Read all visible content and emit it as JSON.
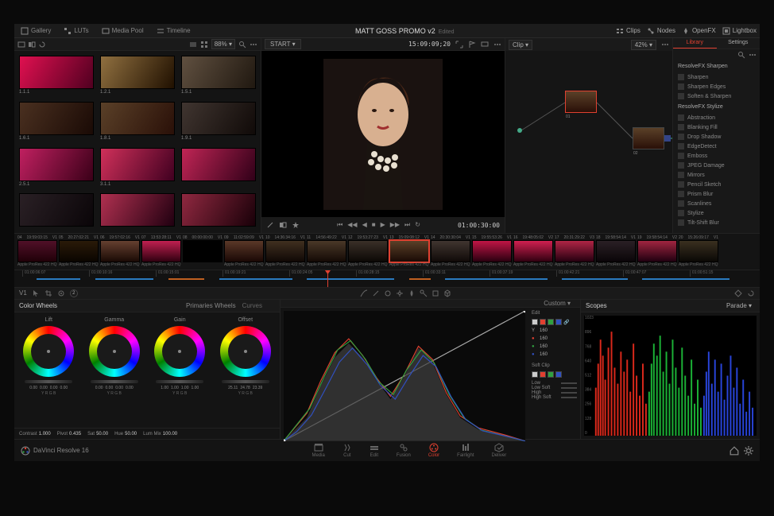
{
  "topbar": {
    "tabs": [
      "Gallery",
      "LUTs",
      "Media Pool",
      "Timeline"
    ],
    "title": "MATT GOSS PROMO v2",
    "edited": "Edited",
    "right": [
      "Clips",
      "Nodes",
      "OpenFX",
      "Lightbox"
    ]
  },
  "gallery": {
    "zoom": "88%",
    "thumbs": [
      {
        "label": "1.1.1",
        "bg": "linear-gradient(120deg,#e01050,#500020)"
      },
      {
        "label": "1.2.1",
        "bg": "linear-gradient(120deg,#907040,#201000)"
      },
      {
        "label": "1.5.1",
        "bg": "linear-gradient(120deg,#605040,#201810)"
      },
      {
        "label": "1.6.1",
        "bg": "linear-gradient(120deg,#4a3020,#1a0a05)"
      },
      {
        "label": "1.8.1",
        "bg": "linear-gradient(120deg,#5a4028,#2a1008)"
      },
      {
        "label": "1.9.1",
        "bg": "linear-gradient(120deg,#403530,#100a08)"
      },
      {
        "label": "2.5.1",
        "bg": "linear-gradient(120deg,#c02060,#3a0018)"
      },
      {
        "label": "3.1.1",
        "bg": "linear-gradient(120deg,#d0305a,#400020)"
      },
      {
        "label": "",
        "bg": "linear-gradient(120deg,#c02555,#300018)"
      },
      {
        "label": "",
        "bg": "linear-gradient(120deg,#2a2025,#0a0508)"
      },
      {
        "label": "",
        "bg": "linear-gradient(120deg,#b03050,#200010)"
      },
      {
        "label": "",
        "bg": "linear-gradient(120deg,#902840,#180008)"
      }
    ]
  },
  "viewer": {
    "start": "START",
    "tc_left": "15:09:09;20",
    "zoom": "42%",
    "tc_right": "01:00:30:00"
  },
  "node_toolbar": {
    "mode": "Clip"
  },
  "library": {
    "tabs": [
      "Library",
      "Settings"
    ],
    "active_tab": 0,
    "groups": [
      {
        "header": "ResolveFX Sharpen",
        "items": [
          "Sharpen",
          "Sharpen Edges",
          "Soften & Sharpen"
        ]
      },
      {
        "header": "ResolveFX Stylize",
        "items": [
          "Abstraction",
          "Blanking Fill",
          "Drop Shadow",
          "EdgeDetect",
          "Emboss",
          "JPEG Damage",
          "Mirrors",
          "Pencil Sketch",
          "Prism Blur",
          "Scanlines",
          "Stylize",
          "Tilt-Shift Blur"
        ]
      }
    ]
  },
  "clips": [
    {
      "n": "04",
      "tc": "19:59:03:15",
      "track": "V1",
      "codec": "Apple ProRes 422 HQ",
      "bg": "linear-gradient(#501028,#200008)"
    },
    {
      "n": "05",
      "tc": "20:27:02:21",
      "track": "V1",
      "codec": "Apple ProRes 422 HQ",
      "bg": "linear-gradient(#2a1a08,#0a0500)"
    },
    {
      "n": "06",
      "tc": "19:57:02:16",
      "track": "V1",
      "codec": "Apple ProRes 422 HQ",
      "bg": "linear-gradient(#654030,#1a0a05)"
    },
    {
      "n": "07",
      "tc": "13:53:28:11",
      "track": "V1",
      "codec": "Apple ProRes 422 HQ",
      "bg": "linear-gradient(#c02050,#300010)"
    },
    {
      "n": "08",
      "tc": "00:00:00:00",
      "track": "V1",
      "codec": "",
      "bg": "#000"
    },
    {
      "n": "09",
      "tc": "11:02:59:09",
      "track": "V1",
      "codec": "Apple ProRes 422 HQ",
      "bg": "linear-gradient(#5a3828,#1a0805)"
    },
    {
      "n": "10",
      "tc": "14:36:34:16",
      "track": "V1",
      "codec": "Apple ProRes 422 HQ",
      "bg": "linear-gradient(#403020,#100805)"
    },
    {
      "n": "11",
      "tc": "14:56:49:22",
      "track": "V1",
      "codec": "Apple ProRes 422 HQ",
      "bg": "linear-gradient(#4a3828,#140a05)"
    },
    {
      "n": "12",
      "tc": "19:53:27:23",
      "track": "V1",
      "codec": "Apple ProRes 422 HQ",
      "bg": "linear-gradient(#3a3028,#0c0805)"
    },
    {
      "n": "13",
      "tc": "15:09:08:12",
      "track": "V1",
      "codec": "Apple ProRes 422 HQ",
      "bg": "linear-gradient(#5a4028,#1a0a05)",
      "selected": true
    },
    {
      "n": "14",
      "tc": "20:30:30:04",
      "track": "V1",
      "codec": "Apple ProRes 422 HQ",
      "bg": "linear-gradient(#403530,#100a08)"
    },
    {
      "n": "15",
      "tc": "19:55:53:26",
      "track": "V1",
      "codec": "Apple ProRes 422 HQ",
      "bg": "linear-gradient(#c01545,#2a0010)"
    },
    {
      "n": "16",
      "tc": "19:48:05:02",
      "track": "V2",
      "codec": "Apple ProRes 422 HQ",
      "bg": "linear-gradient(#d02050,#300010)"
    },
    {
      "n": "17",
      "tc": "20:31:29:22",
      "track": "V3",
      "codec": "Apple ProRes 422 HQ",
      "bg": "linear-gradient(#b02545,#250010)"
    },
    {
      "n": "18",
      "tc": "19:58:54:14",
      "track": "V1",
      "codec": "Apple ProRes 422 HQ",
      "bg": "linear-gradient(#2a2025,#0a0508)"
    },
    {
      "n": "19",
      "tc": "19:58:54:14",
      "track": "V2",
      "codec": "Apple ProRes 422 HQ",
      "bg": "linear-gradient(#a02540,#200010)"
    },
    {
      "n": "20",
      "tc": "15:26:09:17",
      "track": "V1",
      "codec": "Apple ProRes 422 HQ",
      "bg": "linear-gradient(#3a3020,#0a0805)"
    }
  ],
  "timeline_ticks": [
    "01:00:06:07",
    "01:00:10:16",
    "01:00:15:01",
    "01:00:19:21",
    "01:00:24:05",
    "01:00:28:15",
    "01:00:33:11",
    "01:00:37:19",
    "01:00:42:21",
    "01:00:47:07",
    "01:00:51:15"
  ],
  "timeline_tools": {
    "counter": "2"
  },
  "wheels_panel": {
    "title": "Color Wheels",
    "mode": "Primaries Wheels",
    "curves_label": "Curves",
    "wheels": [
      {
        "name": "Lift",
        "nums": [
          "0.00",
          "0.00",
          "0.00",
          "0.00"
        ]
      },
      {
        "name": "Gamma",
        "nums": [
          "0.00",
          "0.00",
          "0.00",
          "0.00"
        ]
      },
      {
        "name": "Gain",
        "nums": [
          "1.00",
          "1.00",
          "1.00",
          "1.00"
        ]
      },
      {
        "name": "Offset",
        "nums": [
          "25.11",
          "24.78",
          "23.39"
        ]
      }
    ],
    "rgb": "Y  R  G  B",
    "params": [
      {
        "label": "Contrast",
        "val": "1.000"
      },
      {
        "label": "Pivot",
        "val": "0.435"
      },
      {
        "label": "Sat",
        "val": "50.00"
      },
      {
        "label": "Hue",
        "val": "50.00"
      },
      {
        "label": "Lum Mix",
        "val": "100.00"
      }
    ]
  },
  "curves": {
    "mode": "Custom",
    "edit_label": "Edit",
    "channels": {
      "Y": "160",
      "R": "160",
      "G": "160",
      "B": "160"
    },
    "softclip_label": "Soft Clip",
    "softclip": [
      {
        "label": "Low",
        "val": ""
      },
      {
        "label": "Low Soft",
        "val": ""
      },
      {
        "label": "High",
        "val": ""
      },
      {
        "label": "High Soft",
        "val": ""
      }
    ]
  },
  "scopes": {
    "title": "Scopes",
    "mode": "Parade",
    "scale": [
      "1023",
      "896",
      "768",
      "640",
      "512",
      "384",
      "256",
      "128",
      "0"
    ]
  },
  "bottom": {
    "brand": "DaVinci Resolve 16",
    "pages": [
      "Media",
      "Cut",
      "Edit",
      "Fusion",
      "Color",
      "Fairlight",
      "Deliver"
    ],
    "active": 4
  }
}
